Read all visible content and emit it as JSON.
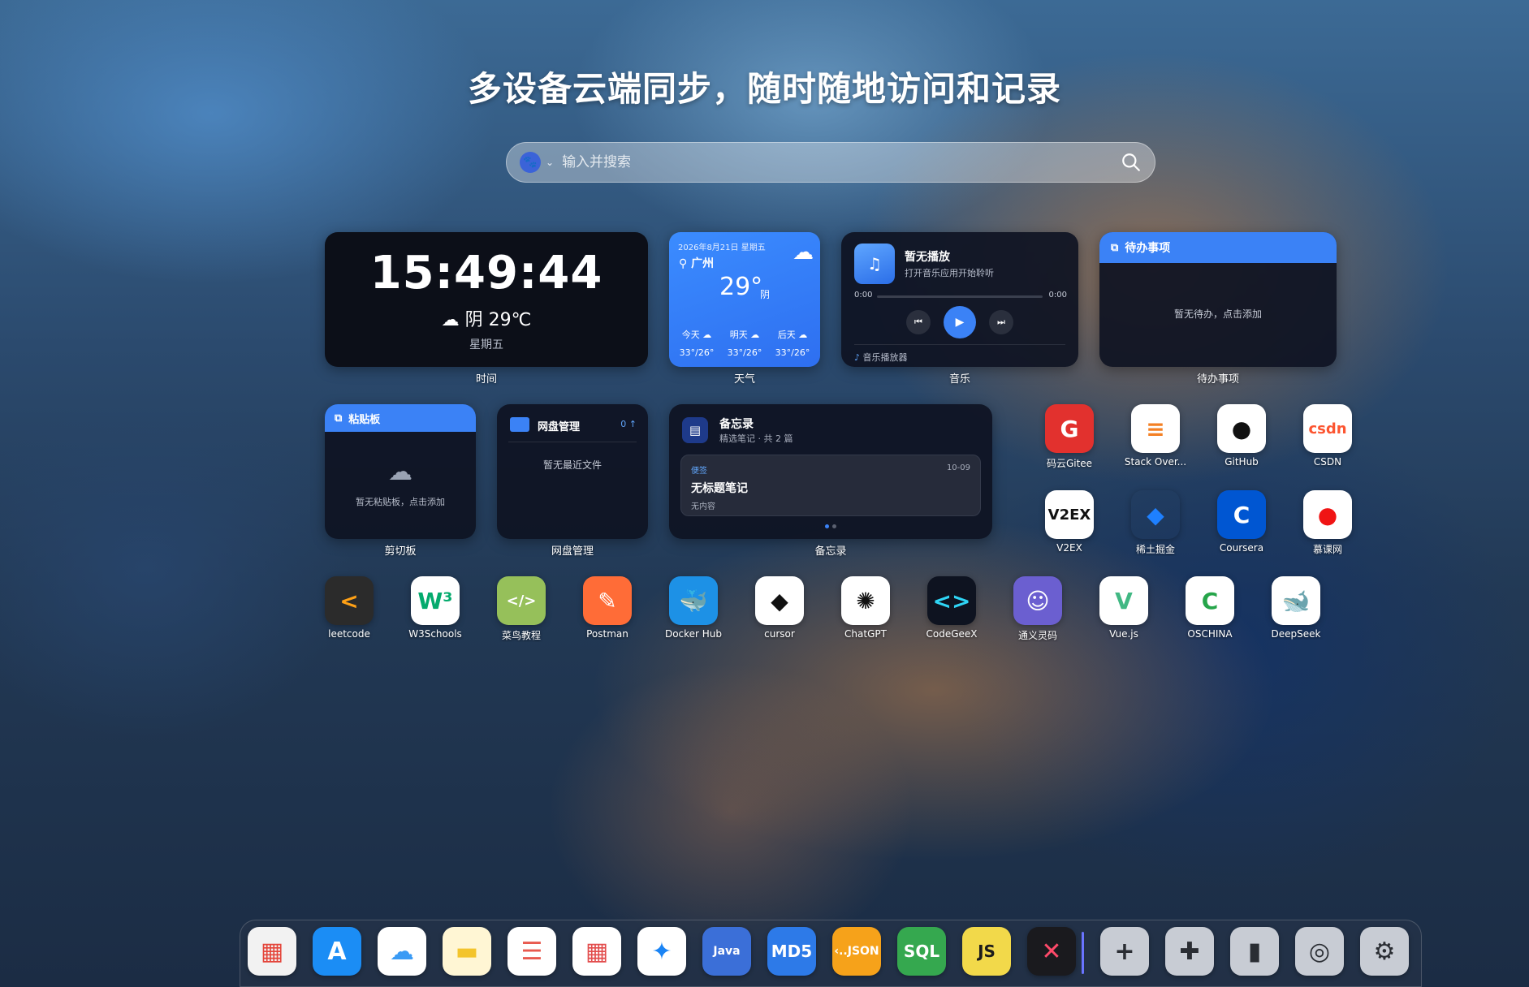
{
  "headline": "多设备云端同步，随时随地访问和记录",
  "search": {
    "placeholder": "输入并搜索",
    "engine_icon": "baidu-paw-icon"
  },
  "clock": {
    "time": "15:49:44",
    "weather": "阴 29℃",
    "weekday": "星期五",
    "caption": "时间"
  },
  "weather": {
    "date": "2026年8月21日 星期五",
    "city": "广州",
    "temp": "29°",
    "condition": "阴",
    "forecast": [
      {
        "day": "今天",
        "range": "33°/26°"
      },
      {
        "day": "明天",
        "range": "33°/26°"
      },
      {
        "day": "后天",
        "range": "33°/26°"
      }
    ],
    "caption": "天气"
  },
  "music": {
    "title": "暂无播放",
    "subtitle": "打开音乐应用开始聆听",
    "time_start": "0:00",
    "time_end": "0:00",
    "footer": "音乐播放器",
    "caption": "音乐"
  },
  "todo": {
    "header": "待办事项",
    "empty": "暂无待办，点击添加",
    "caption": "待办事项"
  },
  "clipboard": {
    "header": "粘贴板",
    "empty": "暂无粘贴板，点击添加",
    "caption": "剪切板"
  },
  "disk": {
    "title": "网盘管理",
    "count": "0 ↑",
    "empty": "暂无最近文件",
    "caption": "网盘管理"
  },
  "memo": {
    "title": "备忘录",
    "subtitle": "精选笔记 · 共 2 篇",
    "note": {
      "tag": "便签",
      "date": "10-09",
      "title": "无标题笔记",
      "content": "无内容"
    },
    "caption": "备忘录"
  },
  "apps": [
    {
      "label": "码云Gitee",
      "icon": "gitee-icon",
      "bg": "#e2312e",
      "text": "G",
      "color": "#ffffff"
    },
    {
      "label": "Stack Over...",
      "icon": "stackoverflow-icon",
      "bg": "#ffffff",
      "text": "≡",
      "color": "#f48024"
    },
    {
      "label": "GitHub",
      "icon": "github-icon",
      "bg": "#ffffff",
      "text": "●",
      "color": "#111111"
    },
    {
      "label": "CSDN",
      "icon": "csdn-icon",
      "bg": "#ffffff",
      "text": "csdn",
      "color": "#fc5531"
    },
    {
      "label": "V2EX",
      "icon": "v2ex-icon",
      "bg": "#ffffff",
      "text": "V2EX",
      "color": "#111111"
    },
    {
      "label": "稀土掘金",
      "icon": "juejin-icon",
      "bg": "transparent",
      "text": "◆",
      "color": "#1e80ff"
    },
    {
      "label": "Coursera",
      "icon": "coursera-icon",
      "bg": "#0056d2",
      "text": "C",
      "color": "#ffffff"
    },
    {
      "label": "慕课网",
      "icon": "imooc-icon",
      "bg": "#ffffff",
      "text": "●",
      "color": "#f01414"
    },
    {
      "label": "leetcode",
      "icon": "leetcode-icon",
      "bg": "#2b2b2b",
      "text": "<",
      "color": "#ffa116"
    },
    {
      "label": "W3Schools",
      "icon": "w3schools-icon",
      "bg": "#ffffff",
      "text": "W³",
      "color": "#04aa6d"
    },
    {
      "label": "菜鸟教程",
      "icon": "runoob-icon",
      "bg": "#96c05a",
      "text": "</>",
      "color": "#ffffff"
    },
    {
      "label": "Postman",
      "icon": "postman-icon",
      "bg": "#ff6c37",
      "text": "✎",
      "color": "#ffffff"
    },
    {
      "label": "Docker Hub",
      "icon": "docker-icon",
      "bg": "#1d91e6",
      "text": "🐳",
      "color": "#ffffff"
    },
    {
      "label": "cursor",
      "icon": "cursor-icon",
      "bg": "#ffffff",
      "text": "◆",
      "color": "#111111"
    },
    {
      "label": "ChatGPT",
      "icon": "chatgpt-icon",
      "bg": "#ffffff",
      "text": "✺",
      "color": "#111111"
    },
    {
      "label": "CodeGeeX",
      "icon": "codegeex-icon",
      "bg": "#0e1320",
      "text": "<>",
      "color": "#2fd5f5"
    },
    {
      "label": "通义灵码",
      "icon": "tongyi-lingma-icon",
      "bg": "#6b5fd0",
      "text": "☺",
      "color": "#ffffff"
    },
    {
      "label": "Vue.js",
      "icon": "vue-icon",
      "bg": "#ffffff",
      "text": "V",
      "color": "#41b883"
    },
    {
      "label": "OSCHINA",
      "icon": "oschina-icon",
      "bg": "#ffffff",
      "text": "C",
      "color": "#26a54a"
    },
    {
      "label": "DeepSeek",
      "icon": "deepseek-icon",
      "bg": "#ffffff",
      "text": "🐋",
      "color": "#4d6bfe"
    }
  ],
  "dock": [
    {
      "icon": "launchpad-grid-icon",
      "bg": "#f2f2f2",
      "text": "▦",
      "color": "#e4453a"
    },
    {
      "icon": "app-store-icon",
      "bg": "#1b8df5",
      "text": "A",
      "color": "#ffffff"
    },
    {
      "icon": "icloud-icon",
      "bg": "#ffffff",
      "text": "☁",
      "color": "#3a9bf5"
    },
    {
      "icon": "notes-icon",
      "bg": "#fff6d4",
      "text": "▬",
      "color": "#f3c42c"
    },
    {
      "icon": "reminders-icon",
      "bg": "#ffffff",
      "text": "☰",
      "color": "#e85a4f"
    },
    {
      "icon": "calendar-icon",
      "bg": "#ffffff",
      "text": "▦",
      "color": "#e24c4c"
    },
    {
      "icon": "safari-icon",
      "bg": "#ffffff",
      "text": "✦",
      "color": "#1a84f5"
    },
    {
      "icon": "java-icon",
      "bg": "#3b6fd8",
      "text": "Java",
      "color": "#ffffff"
    },
    {
      "icon": "md5-shield-icon",
      "bg": "#2d7ae8",
      "text": "MD5",
      "color": "#ffffff"
    },
    {
      "icon": "json-icon",
      "bg": "#f6a21a",
      "text": "‹..JSON",
      "color": "#ffffff"
    },
    {
      "icon": "sql-icon",
      "bg": "#35a84f",
      "text": "SQL",
      "color": "#ffffff"
    },
    {
      "icon": "javascript-icon",
      "bg": "#f2d94a",
      "text": "JS",
      "color": "#1b1b1b"
    },
    {
      "icon": "diff-merge-icon",
      "bg": "#1a1a1e",
      "text": "✕",
      "color": "#ff4a6a"
    },
    {
      "icon": "add-icon",
      "bg": "#c8ccd4",
      "text": "+",
      "color": "#2a2d33"
    },
    {
      "icon": "puzzle-icon",
      "bg": "#c8ccd4",
      "text": "✚",
      "color": "#2a2d33"
    },
    {
      "icon": "brush-icon",
      "bg": "#c8ccd4",
      "text": "▮",
      "color": "#2a2d33"
    },
    {
      "icon": "timer-icon",
      "bg": "#c8ccd4",
      "text": "◎",
      "color": "#2a2d33"
    },
    {
      "icon": "settings-gear-icon",
      "bg": "#c8ccd4",
      "text": "⚙",
      "color": "#2a2d33"
    }
  ]
}
